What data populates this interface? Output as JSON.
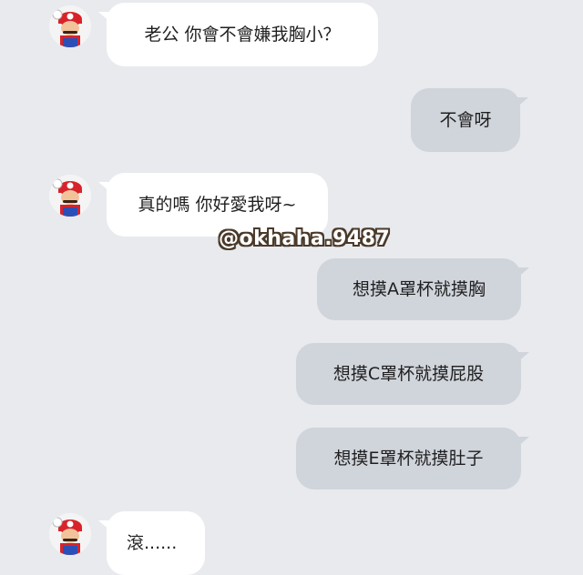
{
  "chat": {
    "messages": [
      {
        "sender": "contact",
        "text": "老公 你會不會嫌我胸小？"
      },
      {
        "sender": "me",
        "text": "不會呀"
      },
      {
        "sender": "contact",
        "text": "真的嗎 你好愛我呀~"
      },
      {
        "sender": "me",
        "text": "想摸A罩杯就摸胸"
      },
      {
        "sender": "me",
        "text": "想摸C罩杯就摸屁股"
      },
      {
        "sender": "me",
        "text": "想摸E罩杯就摸肚子"
      },
      {
        "sender": "contact",
        "text": "滾......"
      }
    ]
  },
  "watermark": "@okhaha.9487",
  "avatar": {
    "icon": "mario-avatar-icon"
  },
  "colors": {
    "background": "#e8eaee",
    "incoming_bubble": "#ffffff",
    "outgoing_bubble": "#d0d4db"
  }
}
